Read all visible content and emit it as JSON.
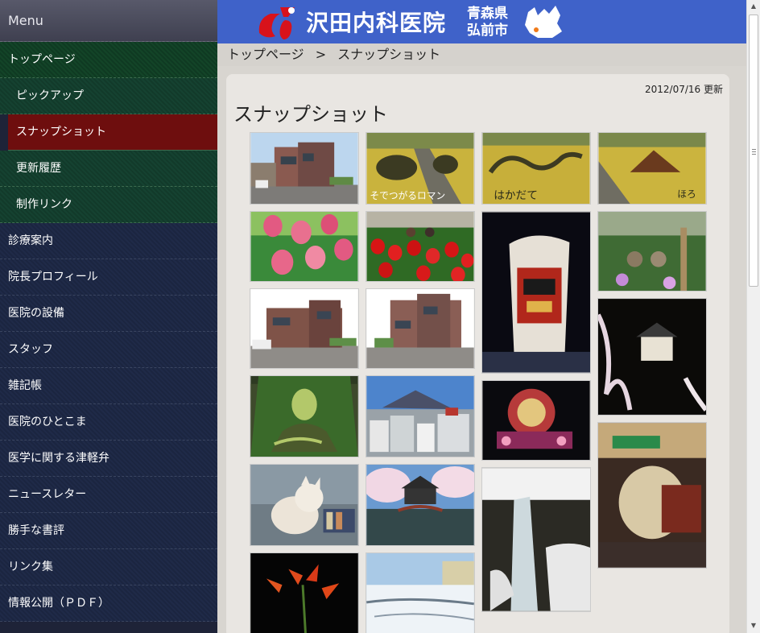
{
  "sidebar": {
    "title": "Menu",
    "items": [
      {
        "label": "トップページ",
        "kind": "top"
      },
      {
        "label": "ピックアップ",
        "kind": "sub"
      },
      {
        "label": "スナップショット",
        "kind": "sub-active"
      },
      {
        "label": "更新履歴",
        "kind": "sub"
      },
      {
        "label": "制作リンク",
        "kind": "sub"
      },
      {
        "label": "診療案内",
        "kind": "item"
      },
      {
        "label": "院長プロフィール",
        "kind": "item"
      },
      {
        "label": "医院の設備",
        "kind": "item"
      },
      {
        "label": "スタッフ",
        "kind": "item"
      },
      {
        "label": "雑記帳",
        "kind": "item"
      },
      {
        "label": "医院のひとこま",
        "kind": "item"
      },
      {
        "label": "医学に関する津軽弁",
        "kind": "item"
      },
      {
        "label": "ニュースレター",
        "kind": "item"
      },
      {
        "label": "勝手な書評",
        "kind": "item"
      },
      {
        "label": "リンク集",
        "kind": "item"
      },
      {
        "label": "情報公開（ＰＤＦ）",
        "kind": "item"
      }
    ]
  },
  "header": {
    "logo_text": "沢田内科医院",
    "prefecture": "青森県",
    "city": "弘前市",
    "colors": {
      "header_bg": "#3f62c9",
      "logo_red": "#d8121b"
    }
  },
  "breadcrumb": {
    "home": "トップページ",
    "separator": ">",
    "current": "スナップショット"
  },
  "content": {
    "updated": "2012/07/16 更新",
    "title": "スナップショット"
  },
  "photos": {
    "caption_rice_art_1": "そでつがるロマン",
    "caption_rice_art_2": "はかだて",
    "caption_rice_art_3": "ほろ"
  }
}
